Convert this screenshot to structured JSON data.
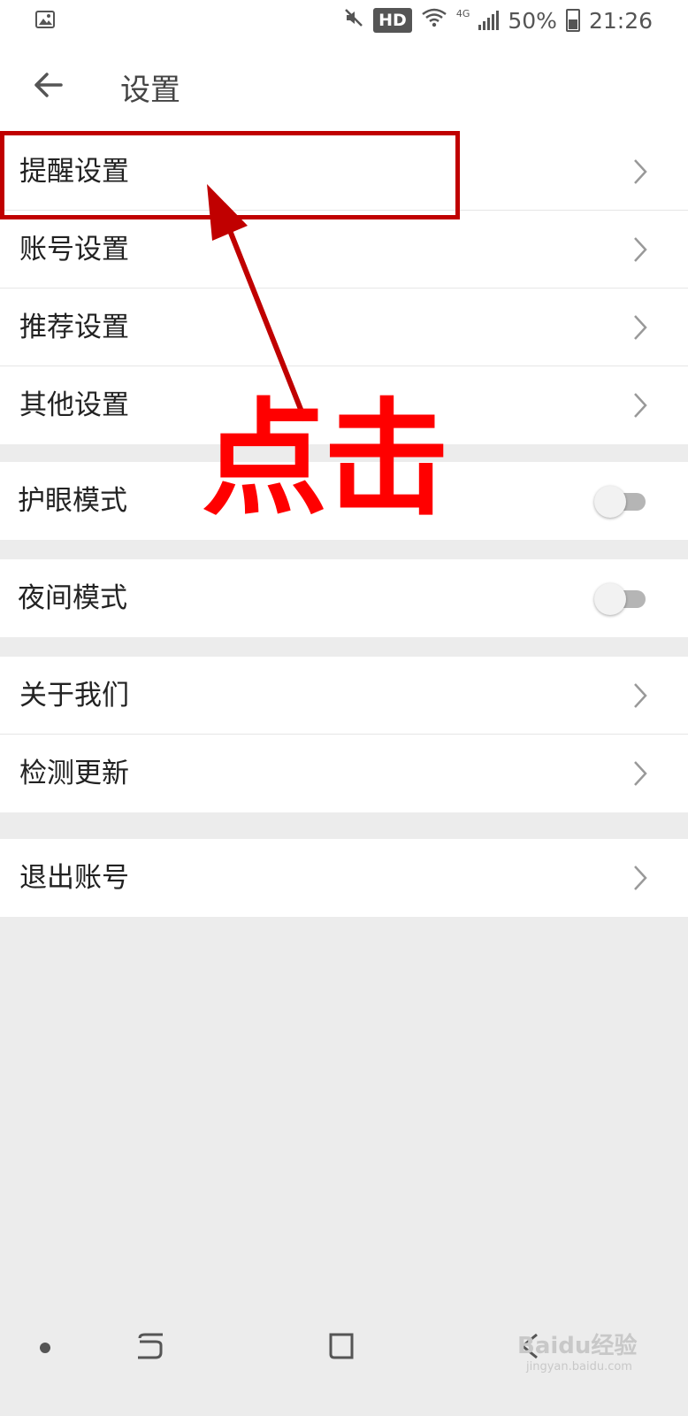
{
  "status_bar": {
    "battery": "50%",
    "time": "21:26",
    "hd_badge": "HD",
    "network": "4G"
  },
  "header": {
    "title": "设置",
    "back_icon": "arrow-left-icon"
  },
  "groups": [
    {
      "items": [
        {
          "label": "提醒设置",
          "type": "link"
        },
        {
          "label": "账号设置",
          "type": "link"
        },
        {
          "label": "推荐设置",
          "type": "link"
        },
        {
          "label": "其他设置",
          "type": "link"
        }
      ]
    },
    {
      "items": [
        {
          "label": "护眼模式",
          "type": "toggle",
          "on": false
        }
      ]
    },
    {
      "items": [
        {
          "label": "夜间模式",
          "type": "toggle",
          "on": false
        }
      ]
    },
    {
      "items": [
        {
          "label": "关于我们",
          "type": "link"
        },
        {
          "label": "检测更新",
          "type": "link"
        }
      ]
    },
    {
      "items": [
        {
          "label": "退出账号",
          "type": "link"
        }
      ]
    }
  ],
  "annotation": {
    "text": "点击",
    "color": "#ff0000",
    "box_color": "#c00000"
  },
  "watermark": {
    "brand": "Baidu经验",
    "url": "jingyan.baidu.com"
  },
  "colors": {
    "background": "#ececec",
    "surface": "#ffffff",
    "toggle_off": "#b5b5b5"
  }
}
